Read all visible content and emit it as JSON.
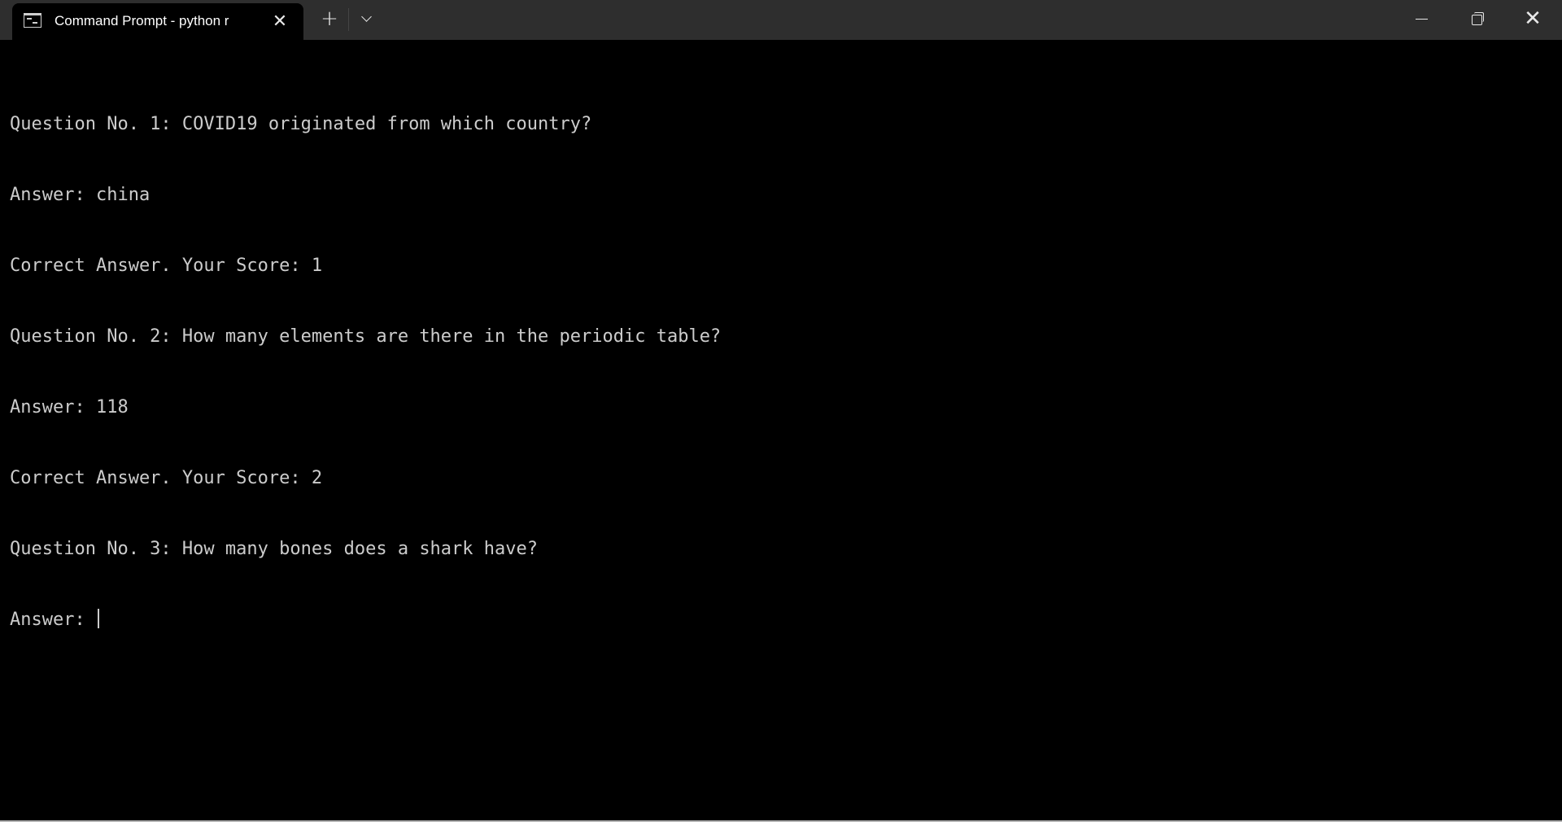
{
  "window": {
    "tab_title": "Command Prompt - python  r",
    "tab_icon": "terminal-icon",
    "close_tab_icon": "close-icon",
    "new_tab_icon": "plus-icon",
    "dropdown_icon": "chevron-down-icon",
    "controls": [
      "minimize-icon",
      "restore-icon",
      "close-icon"
    ]
  },
  "terminal": {
    "lines": [
      "Question No. 1: COVID19 originated from which country?",
      "Answer: china",
      "Correct Answer. Your Score: 1",
      "Question No. 2: How many elements are there in the periodic table?",
      "Answer: 118",
      "Correct Answer. Your Score: 2",
      "Question No. 3: How many bones does a shark have?"
    ],
    "prompt": "Answer: ",
    "input_value": ""
  },
  "colors": {
    "background": "#000000",
    "titlebar": "#2e2e2e",
    "text": "#cccccc"
  }
}
